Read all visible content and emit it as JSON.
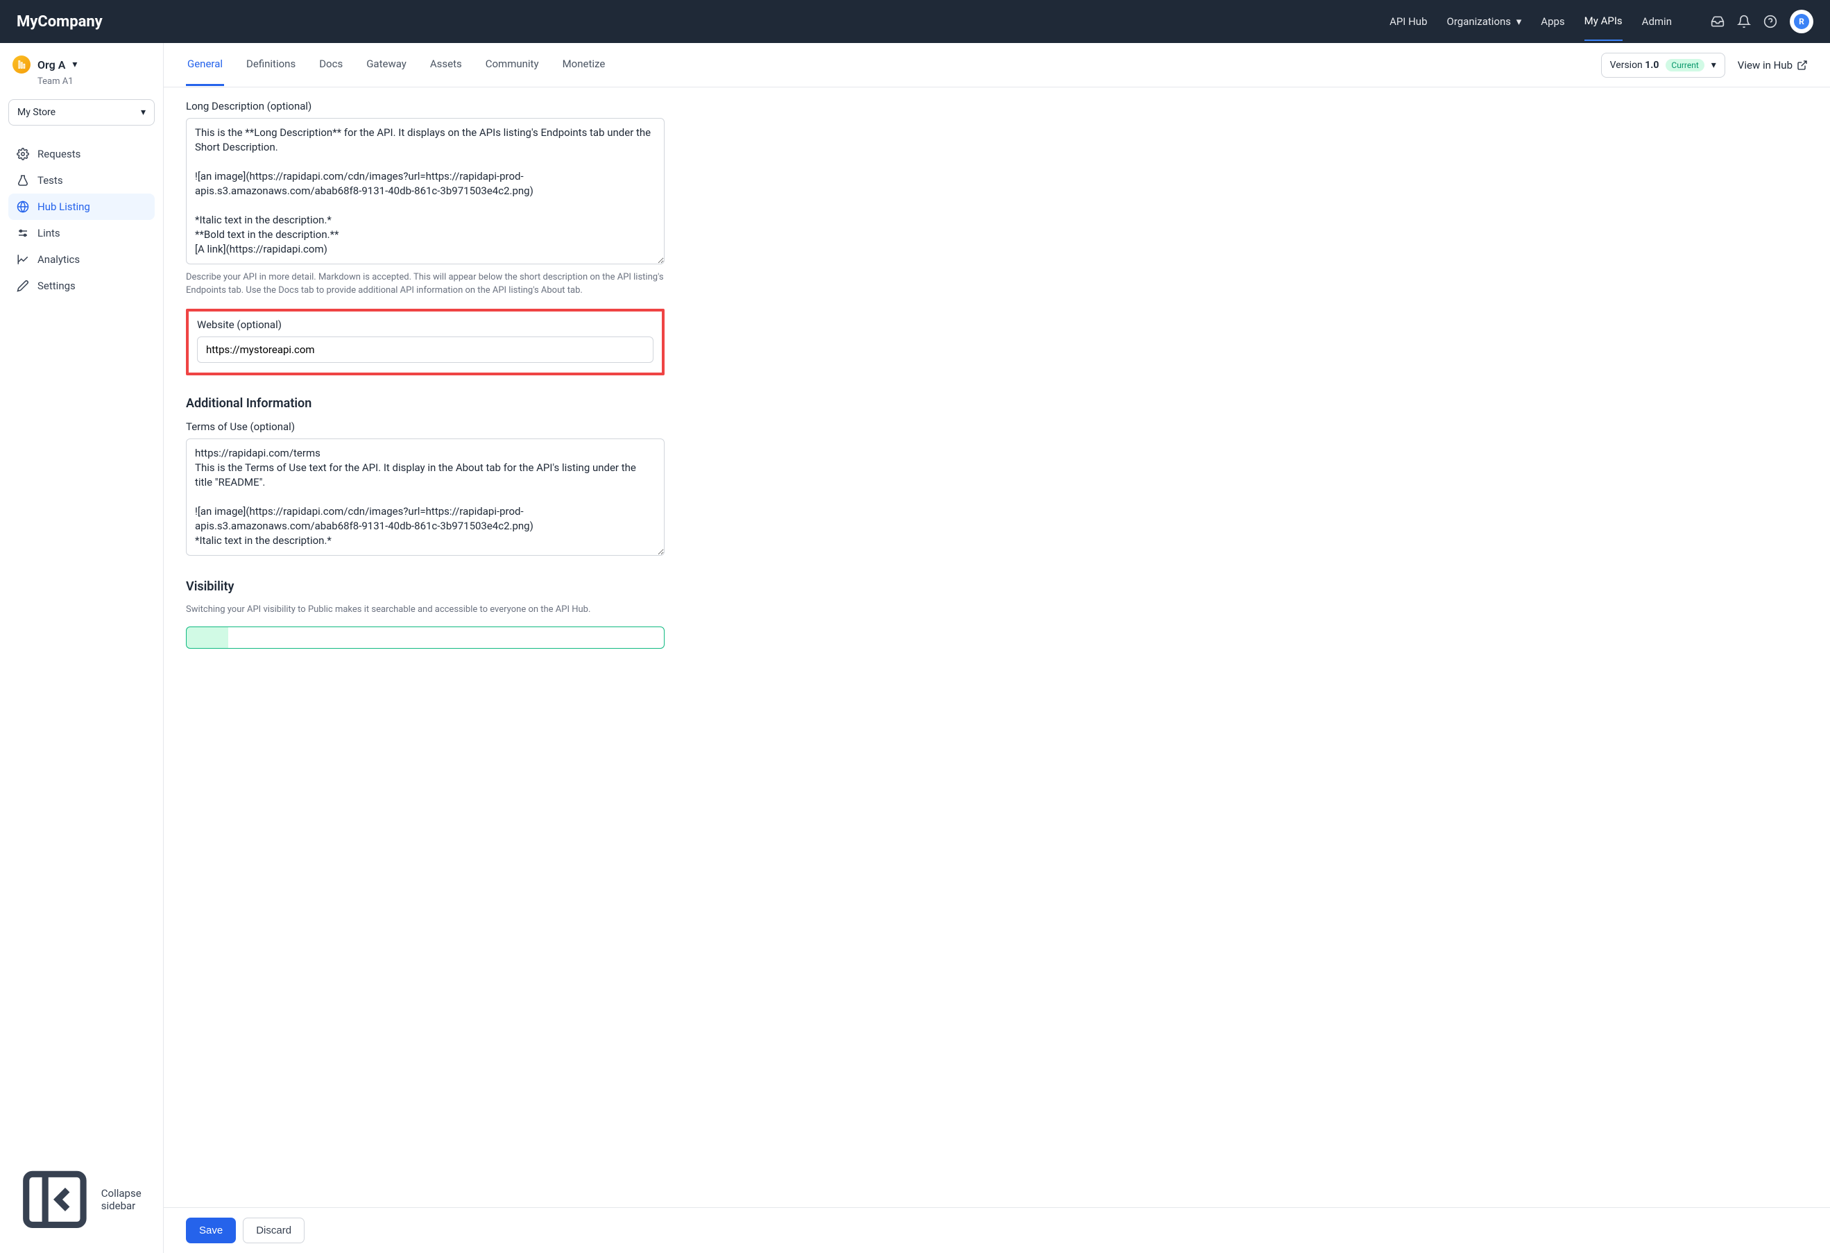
{
  "header": {
    "brand": "MyCompany",
    "nav": {
      "api_hub": "API Hub",
      "organizations": "Organizations",
      "apps": "Apps",
      "my_apis": "My APIs",
      "admin": "Admin"
    },
    "avatar_letter": "R"
  },
  "sidebar": {
    "org_name": "Org A",
    "team_name": "Team A1",
    "store_selected": "My Store",
    "items": [
      {
        "label": "Requests"
      },
      {
        "label": "Tests"
      },
      {
        "label": "Hub Listing"
      },
      {
        "label": "Lints"
      },
      {
        "label": "Analytics"
      },
      {
        "label": "Settings"
      }
    ],
    "collapse_label": "Collapse sidebar"
  },
  "main": {
    "tabs": {
      "general": "General",
      "definitions": "Definitions",
      "docs": "Docs",
      "gateway": "Gateway",
      "assets": "Assets",
      "community": "Community",
      "monetize": "Monetize"
    },
    "version_prefix": "Version ",
    "version_number": "1.0",
    "version_badge": "Current",
    "view_in_hub": "View in Hub"
  },
  "form": {
    "long_desc_label": "Long Description (optional)",
    "long_desc_value": "This is the **Long Description** for the API. It displays on the APIs listing's Endpoints tab under the Short Description.\n\n![an image](https://rapidapi.com/cdn/images?url=https://rapidapi-prod-apis.s3.amazonaws.com/abab68f8-9131-40db-861c-3b971503e4c2.png)\n\n*Italic text in the description.*\n**Bold text in the description.**\n[A link](https://rapidapi.com)",
    "long_desc_help": "Describe your API in more detail. Markdown is accepted. This will appear below the short description on the API listing's Endpoints tab. Use the Docs tab to provide additional API information on the API listing's About tab.",
    "website_label": "Website (optional)",
    "website_value": "https://mystoreapi.com",
    "additional_info_title": "Additional Information",
    "terms_label": "Terms of Use (optional)",
    "terms_value": "https://rapidapi.com/terms\nThis is the Terms of Use text for the API. It display in the About tab for the API's listing under the title \"README\".\n\n![an image](https://rapidapi.com/cdn/images?url=https://rapidapi-prod-apis.s3.amazonaws.com/abab68f8-9131-40db-861c-3b971503e4c2.png)\n*Italic text in the description.*",
    "visibility_title": "Visibility",
    "visibility_help": "Switching your API visibility to Public makes it searchable and accessible to everyone on the API Hub."
  },
  "actions": {
    "save": "Save",
    "discard": "Discard"
  }
}
